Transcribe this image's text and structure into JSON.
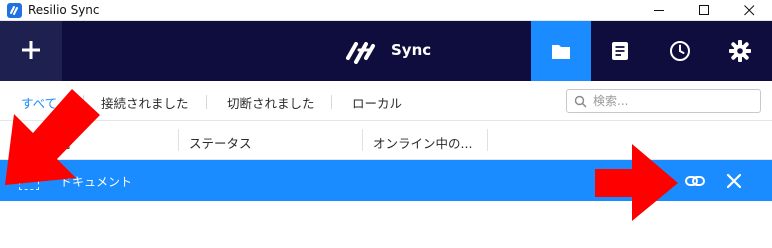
{
  "window": {
    "title": "Resilio Sync"
  },
  "header": {
    "brand": "Sync"
  },
  "tabs": [
    {
      "label": "すべて",
      "active": true
    },
    {
      "label": "接続されました",
      "active": false
    },
    {
      "label": "切断されました",
      "active": false
    },
    {
      "label": "ローカル",
      "active": false
    }
  ],
  "search": {
    "placeholder": "検索..."
  },
  "columns": [
    {
      "label": "名前"
    },
    {
      "label": "ステータス"
    },
    {
      "label": "オンライン中の..."
    }
  ],
  "folders": [
    {
      "name": "ドキュメント"
    }
  ],
  "colors": {
    "header_bg": "#0f0d3d",
    "accent": "#1a8cff",
    "annotation_arrow": "#ff0000"
  }
}
